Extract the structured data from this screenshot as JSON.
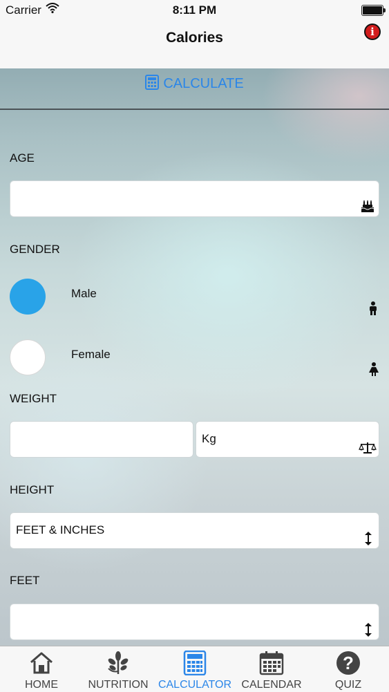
{
  "status": {
    "carrier": "Carrier",
    "time": "8:11 PM"
  },
  "nav": {
    "title": "Calories",
    "info_icon": "info-icon"
  },
  "calculate": {
    "label": "CALCULATE",
    "icon": "calculator-icon",
    "color": "#2b86e8"
  },
  "age": {
    "label": "AGE",
    "value": "",
    "icon": "birthday-cake-icon"
  },
  "gender": {
    "label": "GENDER",
    "options": [
      {
        "label": "Male",
        "selected": true,
        "icon": "male-icon"
      },
      {
        "label": "Female",
        "selected": false,
        "icon": "female-icon"
      }
    ],
    "selected_color": "#29a3e8"
  },
  "weight": {
    "label": "WEIGHT",
    "value": "",
    "unit": "Kg",
    "icon": "scale-icon"
  },
  "height": {
    "label": "HEIGHT",
    "value": "FEET & INCHES",
    "icon": "updown-arrow-icon"
  },
  "feet": {
    "label": "FEET",
    "value": "",
    "icon": "updown-arrow-icon"
  },
  "tabs": [
    {
      "label": "HOME",
      "icon": "home-icon",
      "active": false
    },
    {
      "label": "NUTRITION",
      "icon": "leaf-icon",
      "active": false
    },
    {
      "label": "CALCULATOR",
      "icon": "calculator-icon",
      "active": true
    },
    {
      "label": "CALENDAR",
      "icon": "calendar-icon",
      "active": false
    },
    {
      "label": "QUIZ",
      "icon": "question-icon",
      "active": false
    }
  ]
}
